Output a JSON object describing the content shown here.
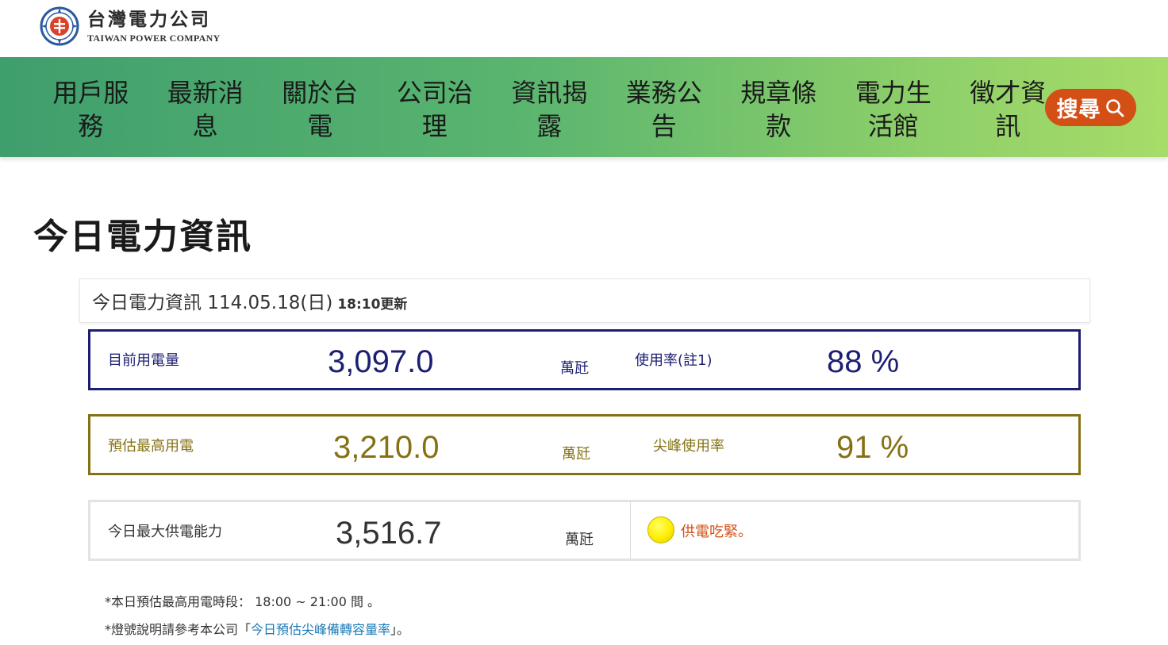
{
  "logo": {
    "name_cn": "台灣電力公司",
    "name_en": "TAIWAN POWER COMPANY",
    "icon": "taipower-logo-icon"
  },
  "nav": {
    "items": [
      {
        "line1": "用戶服",
        "line2": "務"
      },
      {
        "line1": "最新消",
        "line2": "息"
      },
      {
        "line1": "關於台",
        "line2": "電"
      },
      {
        "line1": "公司治",
        "line2": "理"
      },
      {
        "line1": "資訊揭",
        "line2": "露"
      },
      {
        "line1": "業務公",
        "line2": "告"
      },
      {
        "line1": "規章條",
        "line2": "款"
      },
      {
        "line1": "電力生",
        "line2": "活館"
      },
      {
        "line1": "徵才資",
        "line2": "訊"
      }
    ],
    "search_label": "搜尋",
    "search_icon": "search-icon"
  },
  "page": {
    "title": "今日電力資訊"
  },
  "info": {
    "date_text": "今日電力資訊 114.05.18(日)",
    "update_text": "18:10更新",
    "current": {
      "label": "目前用電量",
      "value": "3,097.0",
      "unit": "萬瓩",
      "rate_label": "使用率(註1)",
      "rate_value": "88 %",
      "color": "#1c1e73"
    },
    "peak": {
      "label": "預估最高用電",
      "value": "3,210.0",
      "unit": "萬瓩",
      "rate_label": "尖峰使用率",
      "rate_value": "91 %",
      "color": "#857113"
    },
    "capacity": {
      "label": "今日最大供電能力",
      "value": "3,516.7",
      "unit": "萬瓩",
      "status_text": "供電吃緊。",
      "status_light_color": "#ffee00"
    }
  },
  "notes": {
    "note1": "*本日預估最高用電時段： 18:00 ~ 21:00 間 。",
    "note2_prefix": "*燈號說明請參考本公司「",
    "note2_link": "今日預估尖峰備轉容量率",
    "note2_suffix": "」。"
  },
  "colors": {
    "accent_orange": "#d34f16",
    "nav_green_start": "#3f9e6d",
    "nav_green_end": "#a7dc68",
    "link_blue": "#1a7ab8"
  }
}
